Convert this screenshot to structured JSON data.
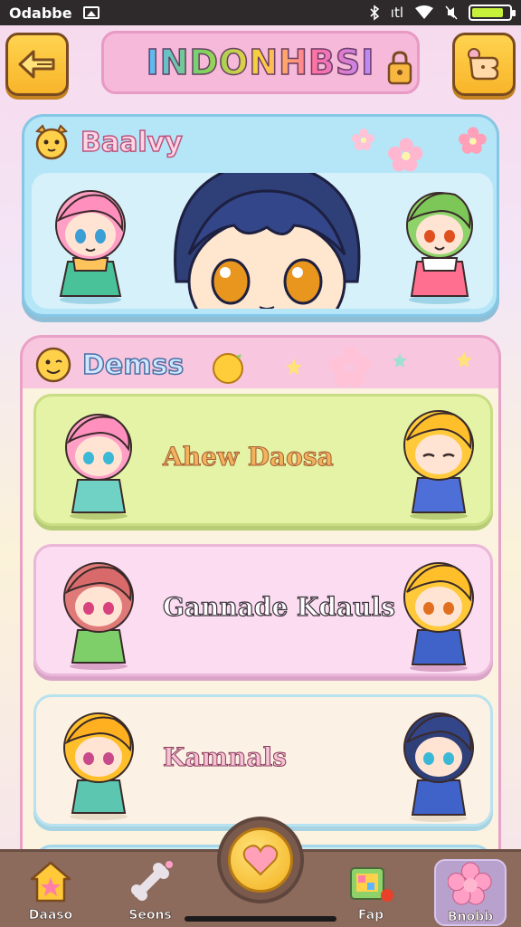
{
  "status_bar": {
    "time": "Odabbe",
    "signal": "ıtl"
  },
  "header": {
    "title": "INDONHBSI"
  },
  "featured": {
    "title": "Baalvy"
  },
  "list": {
    "title": "Demss",
    "rows": [
      {
        "name": "Ahew Daosa"
      },
      {
        "name": "Gannade Kdauls"
      },
      {
        "name": "Kamnals"
      }
    ]
  },
  "nav": {
    "items": [
      {
        "label": "Daaso",
        "icon": "star-house-icon"
      },
      {
        "label": "Seons",
        "icon": "bone-icon"
      },
      {
        "label": "Fap",
        "icon": "gift-box-icon"
      },
      {
        "label": "Bnobb",
        "icon": "flower-icon"
      }
    ],
    "center_icon": "heart-icon"
  },
  "colors": {
    "accent_yellow": "#f8b52a",
    "title_banner": "#f6b9da",
    "featured_panel": "#b5e6f7",
    "list_panel": "#f8c6de",
    "nav_bar": "#8c6a5c"
  }
}
